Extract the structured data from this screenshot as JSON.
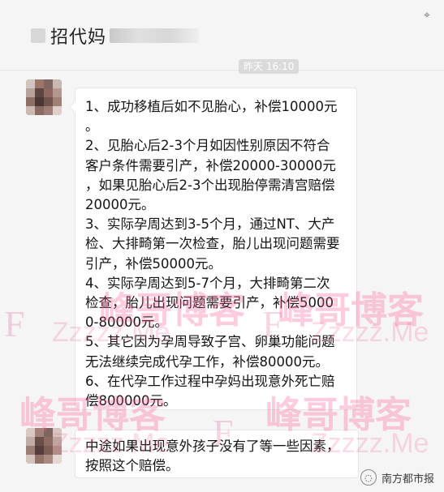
{
  "header": {
    "title": "招代妈",
    "pin_icon": "pin-icon"
  },
  "timestamp": "昨天 16:10",
  "messages": [
    {
      "avatar": "avatar",
      "lines": [
        "1、成功移植后如不见胎心，补偿10000元",
        "。",
        "2、见胎心后2-3个月如因性别原因不符合",
        "客户条件需要引产，补偿20000-30000元",
        "，如果见胎心后2-3个出现胎停需清宫赔偿",
        "20000元。",
        "3、实际孕周达到3-5个月，通过NT、大产",
        "检、大排畸第一次检查，胎儿出现问题需要",
        "引产，补偿50000元。",
        "4、实际孕周达到5-7个月，大排畸第二次",
        "检查，胎儿出现问题需要引产，补偿5000",
        "0-80000元。",
        "5、其它因为孕周导致子宫、卵巢功能问题",
        "无法继续完成代孕工作，补偿80000元。",
        "6、在代孕工作过程中孕妈出现意外死亡赔",
        "偿800000元。"
      ]
    },
    {
      "avatar": "avatar",
      "lines": [
        "中途如果出现意外孩子没有了等一些因素，",
        "按照这个赔偿。"
      ]
    }
  ],
  "watermark": {
    "text_cn": "峰哥博客",
    "text_en": "Zzzzz.Me",
    "letter": "F"
  },
  "source": "南方都市报"
}
